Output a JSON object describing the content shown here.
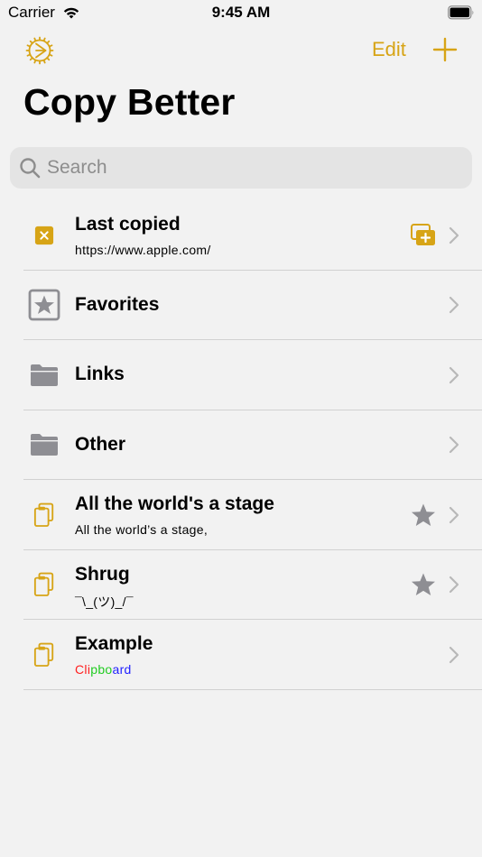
{
  "status_bar": {
    "carrier": "Carrier",
    "time": "9:45 AM"
  },
  "nav": {
    "edit_label": "Edit",
    "title": "Copy Better",
    "accent_color": "#d7a416"
  },
  "search": {
    "placeholder": "Search"
  },
  "list": {
    "items": [
      {
        "title": "Last copied",
        "subtitle": "https://www.apple.com/",
        "icon": "close-box-icon",
        "accessory": "add-to-collection-icon"
      },
      {
        "title": "Favorites",
        "icon": "star-box-icon"
      },
      {
        "title": "Links",
        "icon": "folder-icon"
      },
      {
        "title": "Other",
        "icon": "folder-icon"
      },
      {
        "title": "All the world's a stage",
        "subtitle": "All the world’s a stage,",
        "icon": "clipboard-icon",
        "accessory": "star-icon"
      },
      {
        "title": "Shrug",
        "subtitle": "¯\\_(ツ)_/¯",
        "icon": "clipboard-icon",
        "accessory": "star-icon"
      },
      {
        "title": "Example",
        "subtitle_parts": [
          "Cli",
          "pbo",
          "ard"
        ],
        "icon": "clipboard-icon"
      }
    ]
  }
}
